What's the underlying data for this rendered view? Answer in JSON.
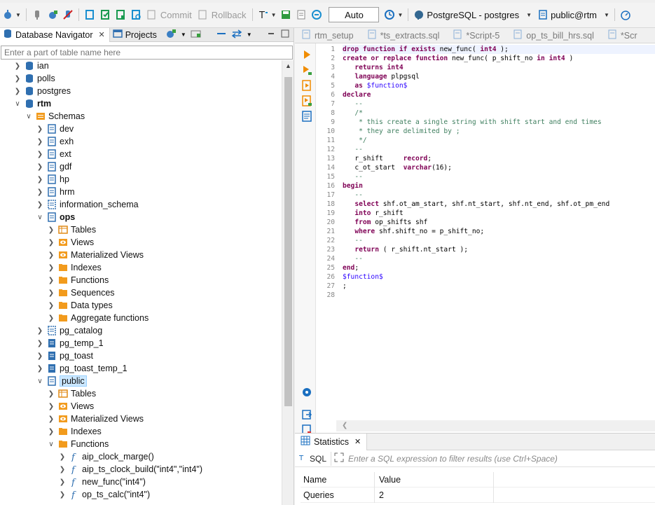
{
  "toolbar": {
    "commit_label": "Commit",
    "rollback_label": "Rollback",
    "transaction_mode": "Auto",
    "connection_label": "PostgreSQL - postgres",
    "schema_label": "public@rtm"
  },
  "navigator": {
    "tab_database": "Database Navigator",
    "tab_projects": "Projects",
    "filter_placeholder": "Enter a part of table name here",
    "items": [
      {
        "label": "ian"
      },
      {
        "label": "polls"
      },
      {
        "label": "postgres"
      },
      {
        "label": "rtm"
      },
      {
        "label": "Schemas"
      },
      {
        "label": "dev"
      },
      {
        "label": "exh"
      },
      {
        "label": "ext"
      },
      {
        "label": "gdf"
      },
      {
        "label": "hp"
      },
      {
        "label": "hrm"
      },
      {
        "label": "information_schema"
      },
      {
        "label": "ops"
      },
      {
        "label": "Tables"
      },
      {
        "label": "Views"
      },
      {
        "label": "Materialized Views"
      },
      {
        "label": "Indexes"
      },
      {
        "label": "Functions"
      },
      {
        "label": "Sequences"
      },
      {
        "label": "Data types"
      },
      {
        "label": "Aggregate functions"
      },
      {
        "label": "pg_catalog"
      },
      {
        "label": "pg_temp_1"
      },
      {
        "label": "pg_toast"
      },
      {
        "label": "pg_toast_temp_1"
      },
      {
        "label": "public"
      },
      {
        "label": "Tables"
      },
      {
        "label": "Views"
      },
      {
        "label": "Materialized Views"
      },
      {
        "label": "Indexes"
      },
      {
        "label": "Functions"
      },
      {
        "label": "aip_clock_marge()"
      },
      {
        "label": "aip_ts_clock_build(\"int4\",\"int4\")"
      },
      {
        "label": "new_func(\"int4\")"
      },
      {
        "label": "op_ts_calc(\"int4\")"
      }
    ]
  },
  "editor": {
    "tabs": [
      "rtm_setup",
      "*ts_extracts.sql",
      "*Script-5",
      "op_ts_bill_hrs.sql",
      "*Scr"
    ],
    "line_numbers": [
      "1",
      "2",
      "3",
      "4",
      "5",
      "6",
      "7",
      "8",
      "9",
      "10",
      "11",
      "12",
      "13",
      "14",
      "15",
      "16",
      "17",
      "18",
      "19",
      "20",
      "21",
      "22",
      "23",
      "24",
      "25",
      "26",
      "27",
      "28"
    ]
  },
  "statistics": {
    "tab_label": "Statistics",
    "sql_label": "SQL",
    "filter_placeholder": "Enter a SQL expression to filter results (use Ctrl+Space)",
    "col_name": "Name",
    "col_value": "Value",
    "rows": [
      {
        "name": "Queries",
        "value": "2"
      }
    ]
  }
}
